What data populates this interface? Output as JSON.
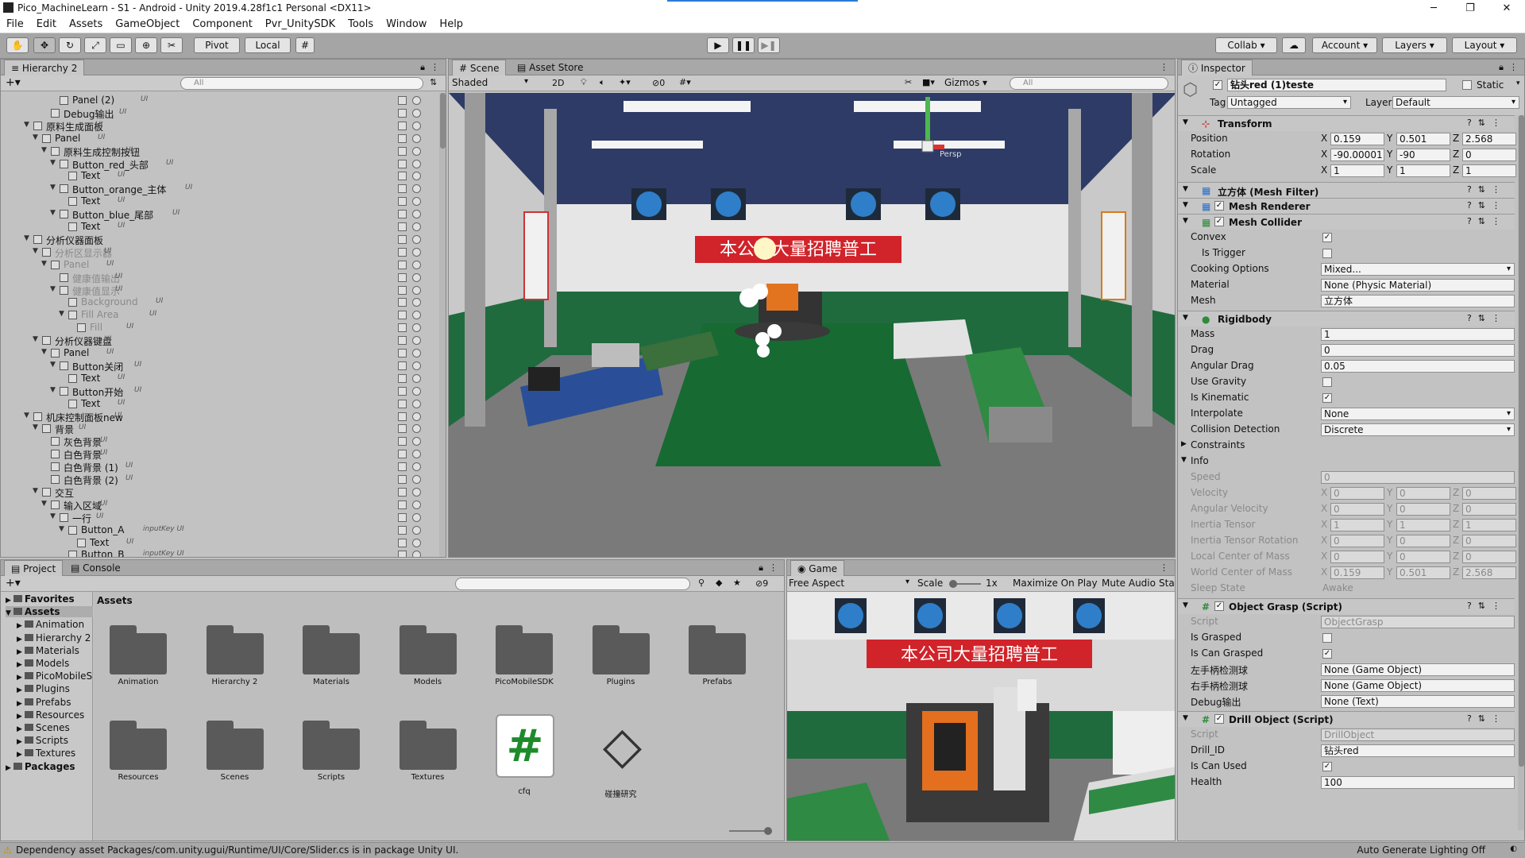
{
  "window": {
    "title": "Pico_MachineLearn - S1 - Android - Unity 2019.4.28f1c1 Personal <DX11>"
  },
  "menu": [
    "File",
    "Edit",
    "Assets",
    "GameObject",
    "Component",
    "Pvr_UnitySDK",
    "Tools",
    "Window",
    "Help"
  ],
  "toolbar": {
    "pivot": "Pivot",
    "local": "Local",
    "collab": "Collab ▾",
    "account": "Account",
    "layers": "Layers",
    "layout": "Layout"
  },
  "hierarchy": {
    "tab": "Hierarchy 2",
    "search_placeholder": "All",
    "rows": [
      {
        "label": "Panel (2)",
        "depth": 6,
        "ui": "UI",
        "arrow": "",
        "dim": false
      },
      {
        "label": "Debug输出",
        "depth": 5,
        "ui": "UI",
        "arrow": "",
        "dim": false
      },
      {
        "label": "原料生成面板",
        "depth": 3,
        "ui": "UI",
        "arrow": "▼",
        "dim": false
      },
      {
        "label": "Panel",
        "depth": 4,
        "ui": "UI",
        "arrow": "▼",
        "dim": false
      },
      {
        "label": "原料生成控制按钮",
        "depth": 5,
        "ui": "UI",
        "arrow": "▼",
        "dim": false
      },
      {
        "label": "Button_red_头部",
        "depth": 6,
        "ui": "UI",
        "arrow": "▼",
        "dim": false
      },
      {
        "label": "Text",
        "depth": 7,
        "ui": "UI",
        "arrow": "",
        "dim": false
      },
      {
        "label": "Button_orange_主体",
        "depth": 6,
        "ui": "UI",
        "arrow": "▼",
        "dim": false
      },
      {
        "label": "Text",
        "depth": 7,
        "ui": "UI",
        "arrow": "",
        "dim": false
      },
      {
        "label": "Button_blue_尾部",
        "depth": 6,
        "ui": "UI",
        "arrow": "▼",
        "dim": false
      },
      {
        "label": "Text",
        "depth": 7,
        "ui": "UI",
        "arrow": "",
        "dim": false
      },
      {
        "label": "分析仪器面板",
        "depth": 3,
        "ui": "",
        "arrow": "▼",
        "dim": false
      },
      {
        "label": "分析区显示器",
        "depth": 4,
        "ui": "UI",
        "arrow": "▼",
        "dim": true
      },
      {
        "label": "Panel",
        "depth": 5,
        "ui": "UI",
        "arrow": "▼",
        "dim": true
      },
      {
        "label": "健康值输出",
        "depth": 6,
        "ui": "UI",
        "arrow": "",
        "dim": true
      },
      {
        "label": "健康值显示",
        "depth": 6,
        "ui": "UI",
        "arrow": "▼",
        "dim": true
      },
      {
        "label": "Background",
        "depth": 7,
        "ui": "UI",
        "arrow": "",
        "dim": true
      },
      {
        "label": "Fill Area",
        "depth": 7,
        "ui": "UI",
        "arrow": "▼",
        "dim": true
      },
      {
        "label": "Fill",
        "depth": 8,
        "ui": "UI",
        "arrow": "",
        "dim": true
      },
      {
        "label": "分析仪器键盘",
        "depth": 4,
        "ui": "UI",
        "arrow": "▼",
        "dim": false
      },
      {
        "label": "Panel",
        "depth": 5,
        "ui": "UI",
        "arrow": "▼",
        "dim": false
      },
      {
        "label": "Button关闭",
        "depth": 6,
        "ui": "UI",
        "arrow": "▼",
        "dim": false
      },
      {
        "label": "Text",
        "depth": 7,
        "ui": "UI",
        "arrow": "",
        "dim": false
      },
      {
        "label": "Button开始",
        "depth": 6,
        "ui": "UI",
        "arrow": "▼",
        "dim": false
      },
      {
        "label": "Text",
        "depth": 7,
        "ui": "UI",
        "arrow": "",
        "dim": false
      },
      {
        "label": "机床控制面板new",
        "depth": 3,
        "ui": "UI",
        "arrow": "▼",
        "dim": false
      },
      {
        "label": "背景",
        "depth": 4,
        "ui": "UI",
        "arrow": "▼",
        "dim": false
      },
      {
        "label": "灰色背景",
        "depth": 5,
        "ui": "UI",
        "arrow": "",
        "dim": false
      },
      {
        "label": "白色背景",
        "depth": 5,
        "ui": "UI",
        "arrow": "",
        "dim": false
      },
      {
        "label": "白色背景 (1)",
        "depth": 5,
        "ui": "UI",
        "arrow": "",
        "dim": false
      },
      {
        "label": "白色背景 (2)",
        "depth": 5,
        "ui": "UI",
        "arrow": "",
        "dim": false
      },
      {
        "label": "交互",
        "depth": 4,
        "ui": "",
        "arrow": "▼",
        "dim": false
      },
      {
        "label": "输入区域",
        "depth": 5,
        "ui": "UI",
        "arrow": "▼",
        "dim": false
      },
      {
        "label": "一行",
        "depth": 6,
        "ui": "UI",
        "arrow": "▼",
        "dim": false
      },
      {
        "label": "Button_A",
        "depth": 7,
        "ui": "inputKey UI",
        "arrow": "▼",
        "dim": false
      },
      {
        "label": "Text",
        "depth": 8,
        "ui": "UI",
        "arrow": "",
        "dim": false
      },
      {
        "label": "Button_B",
        "depth": 7,
        "ui": "inputKey UI",
        "arrow": "",
        "dim": false
      }
    ]
  },
  "scene": {
    "tabs": [
      "Scene",
      "Asset Store"
    ],
    "shading": "Shaded",
    "mode2d": "2D",
    "hidden_count": "0",
    "gizmos": "Gizmos",
    "search_placeholder": "All",
    "persp": "Persp",
    "banner": "本公司大量招聘普工"
  },
  "game": {
    "tab": "Game",
    "aspect": "Free Aspect",
    "scale_label": "Scale",
    "scale_value": "1x",
    "maximize": "Maximize On Play",
    "mute": "Mute Audio",
    "stats": "Sta",
    "banner": "本公司大量招聘普工"
  },
  "project": {
    "tabs": [
      "Project",
      "Console"
    ],
    "hidden_count": "9",
    "tree": [
      {
        "label": "Favorites",
        "bold": true,
        "depth": 0
      },
      {
        "label": "Assets",
        "bold": true,
        "depth": 0
      },
      {
        "label": "Animation",
        "bold": false,
        "depth": 1
      },
      {
        "label": "Hierarchy 2",
        "bold": false,
        "depth": 1
      },
      {
        "label": "Materials",
        "bold": false,
        "depth": 1
      },
      {
        "label": "Models",
        "bold": false,
        "depth": 1
      },
      {
        "label": "PicoMobileS",
        "bold": false,
        "depth": 1
      },
      {
        "label": "Plugins",
        "bold": false,
        "depth": 1
      },
      {
        "label": "Prefabs",
        "bold": false,
        "depth": 1
      },
      {
        "label": "Resources",
        "bold": false,
        "depth": 1
      },
      {
        "label": "Scenes",
        "bold": false,
        "depth": 1
      },
      {
        "label": "Scripts",
        "bold": false,
        "depth": 1
      },
      {
        "label": "Textures",
        "bold": false,
        "depth": 1
      },
      {
        "label": "Packages",
        "bold": true,
        "depth": 0
      }
    ],
    "breadcrumb": "Assets",
    "assets": [
      {
        "label": "Animation",
        "kind": "folder"
      },
      {
        "label": "Hierarchy 2",
        "kind": "folder"
      },
      {
        "label": "Materials",
        "kind": "folder"
      },
      {
        "label": "Models",
        "kind": "folder"
      },
      {
        "label": "PicoMobileSDK",
        "kind": "folder"
      },
      {
        "label": "Plugins",
        "kind": "folder"
      },
      {
        "label": "Prefabs",
        "kind": "folder"
      },
      {
        "label": "Resources",
        "kind": "folder"
      },
      {
        "label": "Scenes",
        "kind": "folder"
      },
      {
        "label": "Scripts",
        "kind": "folder"
      },
      {
        "label": "Textures",
        "kind": "folder"
      },
      {
        "label": "cfq",
        "kind": "script"
      },
      {
        "label": "碰撞研究",
        "kind": "unity"
      }
    ]
  },
  "inspector": {
    "tab": "Inspector",
    "object_name": "钻头red (1)teste",
    "static_label": "Static",
    "tag_label": "Tag",
    "tag_value": "Untagged",
    "layer_label": "Layer",
    "layer_value": "Default",
    "transform": {
      "title": "Transform",
      "position": [
        "0.159",
        "0.501",
        "2.568"
      ],
      "rotation": [
        "-90.00001",
        "-90",
        "0"
      ],
      "scale": [
        "1",
        "1",
        "1"
      ],
      "labels": [
        "Position",
        "Rotation",
        "Scale"
      ]
    },
    "components": [
      "立方体 (Mesh Filter)",
      "Mesh Renderer",
      "Mesh Collider",
      "Rigidbody",
      "Object Grasp (Script)",
      "Drill Object (Script)"
    ],
    "mesh_collider": {
      "convex": "Convex",
      "is_trigger": "Is Trigger",
      "cooking": "Cooking Options",
      "cooking_value": "Mixed...",
      "material": "Material",
      "material_value": "None (Physic Material)",
      "mesh": "Mesh",
      "mesh_value": "立方体"
    },
    "rigidbody": {
      "mass_l": "Mass",
      "mass": "1",
      "drag_l": "Drag",
      "drag": "0",
      "adrag_l": "Angular Drag",
      "adrag": "0.05",
      "gravity_l": "Use Gravity",
      "kinematic_l": "Is Kinematic",
      "interp_l": "Interpolate",
      "interp": "None",
      "coll_l": "Collision Detection",
      "coll": "Discrete",
      "constraints": "Constraints",
      "info": "Info",
      "speed_l": "Speed",
      "speed": "0",
      "velocity_l": "Velocity",
      "velocity": [
        "0",
        "0",
        "0"
      ],
      "angvel_l": "Angular Velocity",
      "angvel": [
        "0",
        "0",
        "0"
      ],
      "itensor_l": "Inertia Tensor",
      "itensor": [
        "1",
        "1",
        "1"
      ],
      "itrot_l": "Inertia Tensor Rotation",
      "itrot": [
        "0",
        "0",
        "0"
      ],
      "lcom_l": "Local Center of Mass",
      "lcom": [
        "0",
        "0",
        "0"
      ],
      "wcom_l": "World Center of Mass",
      "wcom": [
        "0.159",
        "0.501",
        "2.568"
      ],
      "sleep_l": "Sleep State",
      "sleep": "Awake"
    },
    "grasp": {
      "script_l": "Script",
      "script": "ObjectGrasp",
      "isgrasped": "Is Grasped",
      "cangrasp": "Is Can Grasped",
      "left": "左手柄检测球",
      "left_v": "None (Game Object)",
      "right": "右手柄检测球",
      "right_v": "None (Game Object)",
      "debug": "Debug输出",
      "debug_v": "None (Text)"
    },
    "drill": {
      "script_l": "Script",
      "script": "DrillObject",
      "id_l": "Drill_ID",
      "id": "钻头red",
      "canused": "Is Can Used",
      "health_l": "Health",
      "health": "100"
    }
  },
  "status": {
    "message": "Dependency asset Packages/com.unity.ugui/Runtime/UI/Core/Slider.cs is in package Unity UI.",
    "right": "Auto Generate Lighting Off"
  }
}
